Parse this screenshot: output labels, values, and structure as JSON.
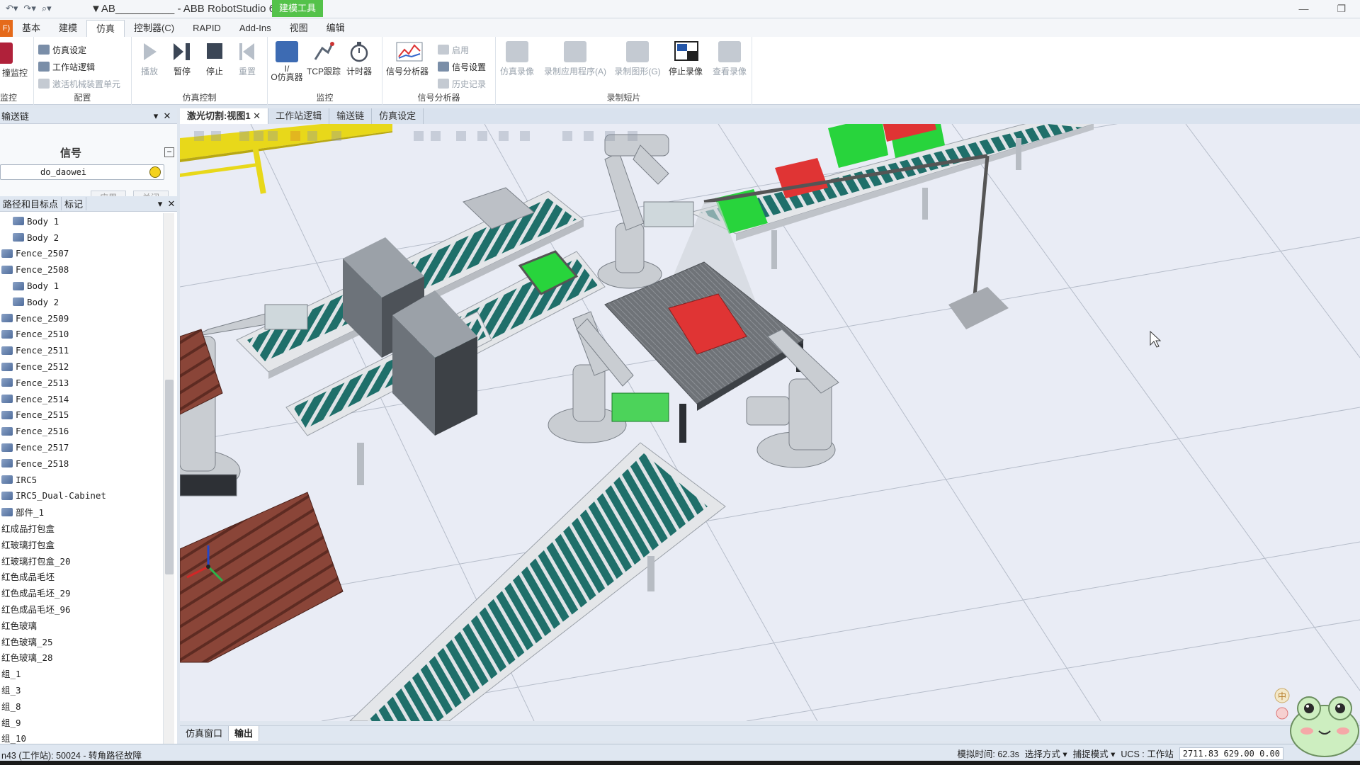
{
  "titlebar": {
    "doc_title": "▼AB__________ - ABB RobotStudio 6...",
    "context_tab": "建模工具",
    "qat_icons": [
      "undo-icon",
      "redo-icon",
      "customize-icon"
    ]
  },
  "ribbon_tabs": {
    "file": "F)",
    "tabs": [
      "基本",
      "建模",
      "仿真",
      "控制器(C)",
      "RAPID",
      "Add-Ins",
      "视图",
      "编辑"
    ],
    "active_index": 2
  },
  "ribbon": {
    "monitor_partial": "撞监控",
    "monitor_group": "监控",
    "config": {
      "label": "配置",
      "sim_setup": "仿真设定",
      "station_logic": "工作站逻辑",
      "activate_units": "激活机械装置单元"
    },
    "sim_control": {
      "label": "仿真控制",
      "play": "播放",
      "pause": "暂停",
      "stop": "停止",
      "reset": "重置"
    },
    "monitor": {
      "label": "监控",
      "io_sim_l1": "I/",
      "io_sim_l2": "O仿真器",
      "tcp_trace": "TCP跟踪",
      "timer": "计时器"
    },
    "signal_analyzer": {
      "label": "信号分析器",
      "analyzer": "信号分析器",
      "enable": "启用",
      "signal_setup": "信号设置",
      "history": "历史记录"
    },
    "record": {
      "label": "录制短片",
      "sim_record": "仿真录像",
      "record_app": "录制应用程序(A)",
      "record_graphics": "录制图形(G)",
      "stop_record": "停止录像",
      "view_record": "查看录像"
    }
  },
  "conveyor_panel": {
    "title": "输送链",
    "header": "信号",
    "signal_name": "do_daowei",
    "apply": "应用",
    "close": "关闭"
  },
  "tree_panel": {
    "tab_paths": "路径和目标点",
    "tab_tags": "标记",
    "items": [
      {
        "label": "Body  1",
        "level": 1,
        "icon": "body-icon"
      },
      {
        "label": "Body  2",
        "level": 1,
        "icon": "body-icon"
      },
      {
        "label": "Fence_2507",
        "level": 0,
        "icon": "part-icon"
      },
      {
        "label": "Fence_2508",
        "level": 0,
        "icon": "part-icon"
      },
      {
        "label": "Body  1",
        "level": 1,
        "icon": "body-icon"
      },
      {
        "label": "Body  2",
        "level": 1,
        "icon": "body-icon"
      },
      {
        "label": "Fence_2509",
        "level": 0,
        "icon": "part-icon"
      },
      {
        "label": "Fence_2510",
        "level": 0,
        "icon": "part-icon"
      },
      {
        "label": "Fence_2511",
        "level": 0,
        "icon": "part-icon"
      },
      {
        "label": "Fence_2512",
        "level": 0,
        "icon": "part-icon"
      },
      {
        "label": "Fence_2513",
        "level": 0,
        "icon": "part-icon"
      },
      {
        "label": "Fence_2514",
        "level": 0,
        "icon": "part-icon"
      },
      {
        "label": "Fence_2515",
        "level": 0,
        "icon": "part-icon"
      },
      {
        "label": "Fence_2516",
        "level": 0,
        "icon": "part-icon"
      },
      {
        "label": "Fence_2517",
        "level": 0,
        "icon": "part-icon"
      },
      {
        "label": "Fence_2518",
        "level": 0,
        "icon": "part-icon"
      },
      {
        "label": "IRC5",
        "level": 0,
        "icon": "part-icon"
      },
      {
        "label": "IRC5_Dual-Cabinet",
        "level": 0,
        "icon": "part-icon"
      },
      {
        "label": "部件_1",
        "level": 0,
        "icon": "part-icon"
      },
      {
        "label": "红成品打包盒",
        "level": 0,
        "icon": "none"
      },
      {
        "label": "红玻璃打包盒",
        "level": 0,
        "icon": "none"
      },
      {
        "label": "红玻璃打包盒_20",
        "level": 0,
        "icon": "none"
      },
      {
        "label": "红色成品毛坯",
        "level": 0,
        "icon": "none"
      },
      {
        "label": "红色成品毛坯_29",
        "level": 0,
        "icon": "none"
      },
      {
        "label": "红色成品毛坯_96",
        "level": 0,
        "icon": "none"
      },
      {
        "label": "红色玻璃",
        "level": 0,
        "icon": "none"
      },
      {
        "label": "红色玻璃_25",
        "level": 0,
        "icon": "none"
      },
      {
        "label": "红色玻璃_28",
        "level": 0,
        "icon": "none"
      },
      {
        "label": "组_1",
        "level": 0,
        "icon": "none"
      },
      {
        "label": "组_3",
        "level": 0,
        "icon": "none"
      },
      {
        "label": "组_8",
        "level": 0,
        "icon": "none"
      },
      {
        "label": "组_9",
        "level": 0,
        "icon": "none"
      },
      {
        "label": "组_10",
        "level": 0,
        "icon": "none"
      }
    ]
  },
  "doc_tabs": [
    {
      "label": "激光切割:视图1 ✕",
      "active": true
    },
    {
      "label": "工作站逻辑",
      "active": false
    },
    {
      "label": "输送链",
      "active": false
    },
    {
      "label": "仿真设定",
      "active": false
    }
  ],
  "bottom_tabs": [
    {
      "label": "仿真窗口",
      "active": false
    },
    {
      "label": "输出",
      "active": true
    }
  ],
  "statusbar": {
    "message": "n43 (工作站): 50024 - 转角路径故障",
    "sim_time": "模拟时间: 62.3s",
    "select_mode": "选择方式 ▾",
    "snap_mode": "捕捉模式 ▾",
    "ucs": "UCS : 工作站",
    "coords": "2711.83   629.00   0.00"
  },
  "colors": {
    "conveyor_belt": "#1f6f6a",
    "glass_green": "#28d43c",
    "glass_red": "#e03434",
    "pallet": "#8a4538",
    "context_tab": "#54c24a",
    "file_tab": "#e56a1a"
  }
}
